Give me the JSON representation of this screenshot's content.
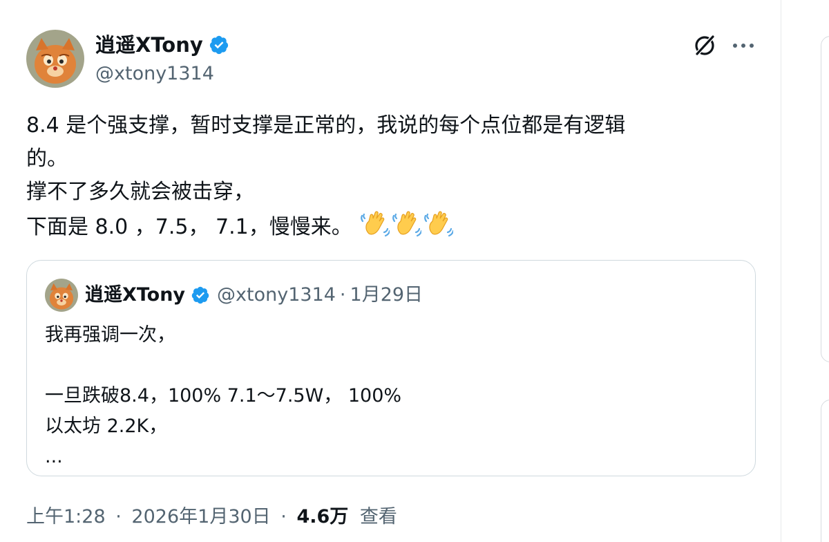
{
  "tweet": {
    "author": {
      "name": "逍遥XTony",
      "handle": "@xtony1314",
      "verified": true
    },
    "text_lines": [
      "8.4 是个强支撑，暂时支撑是正常的，我说的每个点位都是有逻辑",
      "的。",
      "撑不了多久就会被击穿，",
      "下面是 8.0 ，7.5， 7.1，慢慢来。"
    ],
    "emojis": [
      "waving-hand",
      "waving-hand",
      "waving-hand"
    ],
    "quoted": {
      "name": "逍遥XTony",
      "handle": "@xtony1314",
      "separator": "·",
      "date": "1月29日",
      "text_lines": [
        "我再强调一次，",
        "",
        "一旦跌破8.4，100% 7.1～7.5W， 100%",
        "以太坊 2.2K，",
        "..."
      ]
    },
    "footer": {
      "time": "上午1:28",
      "sep1": "·",
      "date": "2026年1月30日",
      "sep2": "·",
      "views_count": "4.6万",
      "views_label": "查看"
    }
  },
  "colors": {
    "text_primary": "#0f1419",
    "text_secondary": "#536471",
    "verified_blue": "#1d9bf0",
    "border": "#cfd9de"
  },
  "icons": [
    "grok-icon",
    "more-icon",
    "verified-badge-icon",
    "waving-hand-icon"
  ]
}
